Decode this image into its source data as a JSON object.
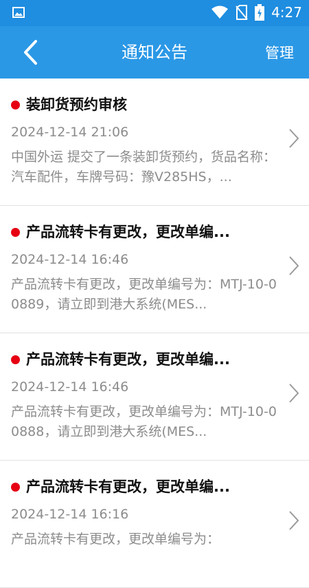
{
  "status_bar": {
    "time": "4:27",
    "icons": [
      "image-notification-icon",
      "wifi-icon",
      "no-sim-icon",
      "battery-charging-icon"
    ]
  },
  "header": {
    "title": "通知公告",
    "manage_label": "管理",
    "back_icon": "back-arrow-icon"
  },
  "notices": [
    {
      "title": "装卸货预约审核",
      "time": "2024-12-14 21:06",
      "description": "中国外运 提交了一条装卸货预约，货品名称：汽车配件，车牌号码：豫V285HS，...",
      "unread": true
    },
    {
      "title": "产品流转卡有更改，更改单编...",
      "time": "2024-12-14 16:46",
      "description": "产品流转卡有更改，更改单编号为：MTJ-10-00889，请立即到港大系统(MES...",
      "unread": true
    },
    {
      "title": "产品流转卡有更改，更改单编...",
      "time": "2024-12-14 16:46",
      "description": "产品流转卡有更改，更改单编号为：MTJ-10-00888，请立即到港大系统(MES...",
      "unread": true
    },
    {
      "title": "产品流转卡有更改，更改单编...",
      "time": "2024-12-14 16:16",
      "description": "产品流转卡有更改，更改单编号为：",
      "unread": true
    }
  ],
  "colors": {
    "status_bar": "#1f8de0",
    "app_bar": "#2b98e6",
    "unread_dot": "#e60012",
    "secondary_text": "#8c8c8c"
  }
}
